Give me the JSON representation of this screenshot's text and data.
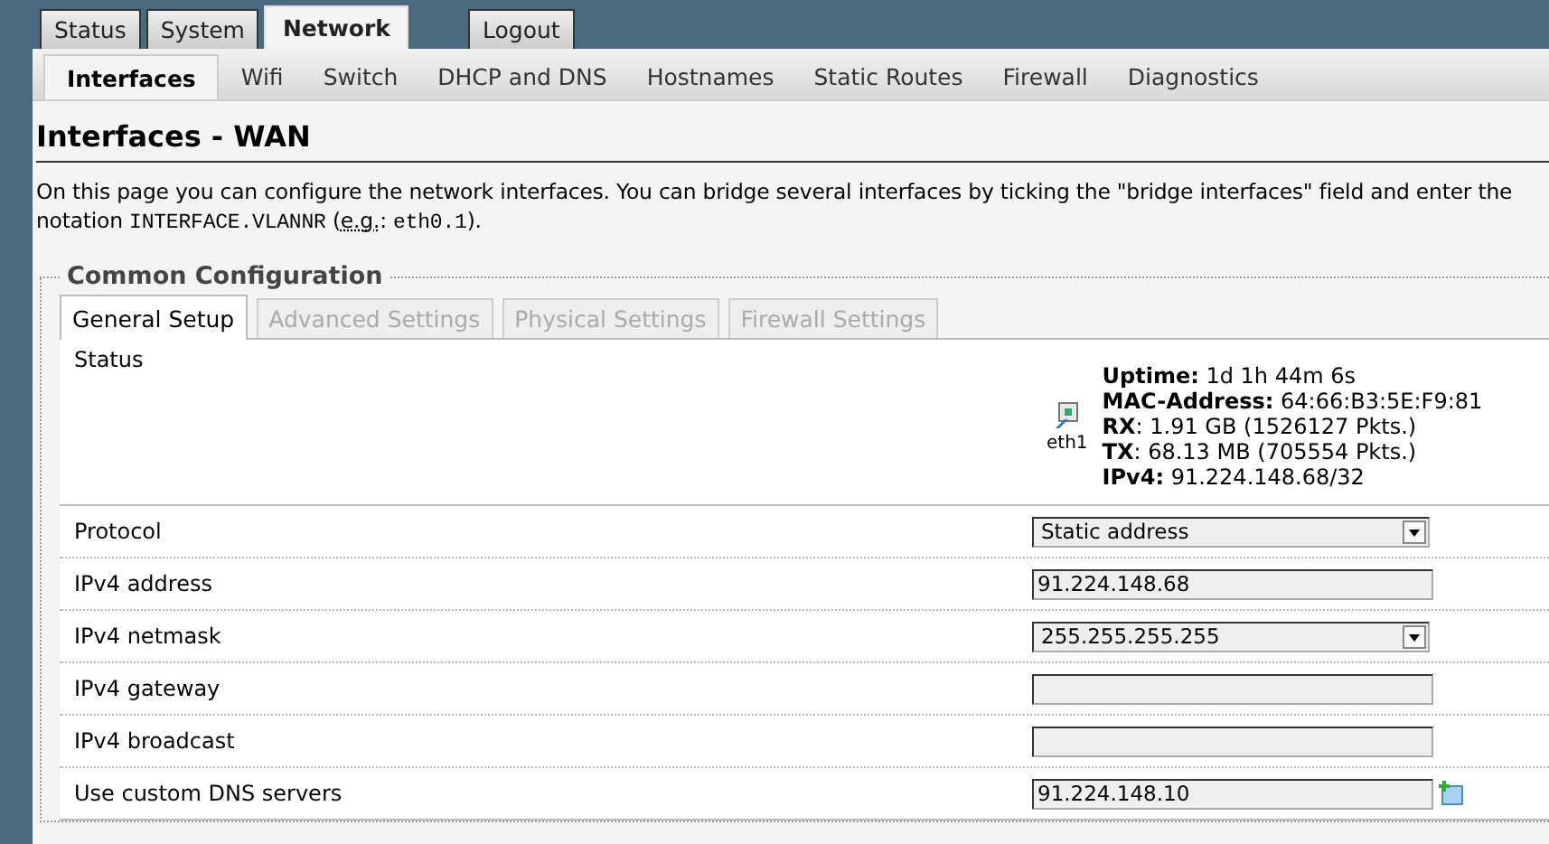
{
  "top_tabs": [
    {
      "label": "Status",
      "kind": "tab",
      "selected": false
    },
    {
      "label": "System",
      "kind": "tab",
      "selected": false
    },
    {
      "label": "Network",
      "kind": "tab",
      "selected": true
    },
    {
      "label": "Logout",
      "kind": "action",
      "selected": false
    }
  ],
  "sub_tabs": [
    {
      "label": "Interfaces",
      "selected": true
    },
    {
      "label": "Wifi",
      "selected": false
    },
    {
      "label": "Switch",
      "selected": false
    },
    {
      "label": "DHCP and DNS",
      "selected": false
    },
    {
      "label": "Hostnames",
      "selected": false
    },
    {
      "label": "Static Routes",
      "selected": false
    },
    {
      "label": "Firewall",
      "selected": false
    },
    {
      "label": "Diagnostics",
      "selected": false
    }
  ],
  "page_title": "Interfaces - WAN",
  "description": {
    "line_1": "On this page you can configure the network interfaces. You can bridge several interfaces by ticking the \"bridge interfaces\" field and enter the",
    "line_2": [
      {
        "text": "notation ",
        "kind": "plain"
      },
      {
        "text": "INTERFACE.VLANNR",
        "kind": "code"
      },
      {
        "text": " (",
        "kind": "plain"
      },
      {
        "text": "e.g.",
        "kind": "abbreviation"
      },
      {
        "text": ": ",
        "kind": "plain"
      },
      {
        "text": "eth0.1",
        "kind": "code"
      },
      {
        "text": ").",
        "kind": "plain"
      }
    ]
  },
  "section": {
    "legend": "Common Configuration",
    "tabs": [
      {
        "label": "General Setup",
        "selected": true
      },
      {
        "label": "Advanced Settings",
        "selected": false
      },
      {
        "label": "Physical Settings",
        "selected": false
      },
      {
        "label": "Firewall Settings",
        "selected": false
      }
    ],
    "status": {
      "label": "Status",
      "interface": "eth1",
      "lines": [
        "**Uptime:** 1d 1h 44m 6s",
        "**MAC-Address:** 64:66:B3:5E:F9:81",
        "**RX**: 1.91 GB (1526127 Pkts.)",
        "**TX**: 68.13 MB (705554 Pkts.)",
        "**IPv4:** 91.224.148.68/32"
      ]
    },
    "fields": [
      {
        "label": "Protocol",
        "kind": "select",
        "value": "Static address"
      },
      {
        "label": "IPv4 address",
        "kind": "text",
        "value": "91.224.148.68"
      },
      {
        "label": "IPv4 netmask",
        "kind": "select",
        "value": "255.255.255.255"
      },
      {
        "label": "IPv4 gateway",
        "kind": "text"
      },
      {
        "label": "IPv4 broadcast",
        "kind": "text"
      },
      {
        "label": "Use custom DNS servers",
        "kind": "list",
        "value": "91.224.148.10"
      }
    ]
  }
}
